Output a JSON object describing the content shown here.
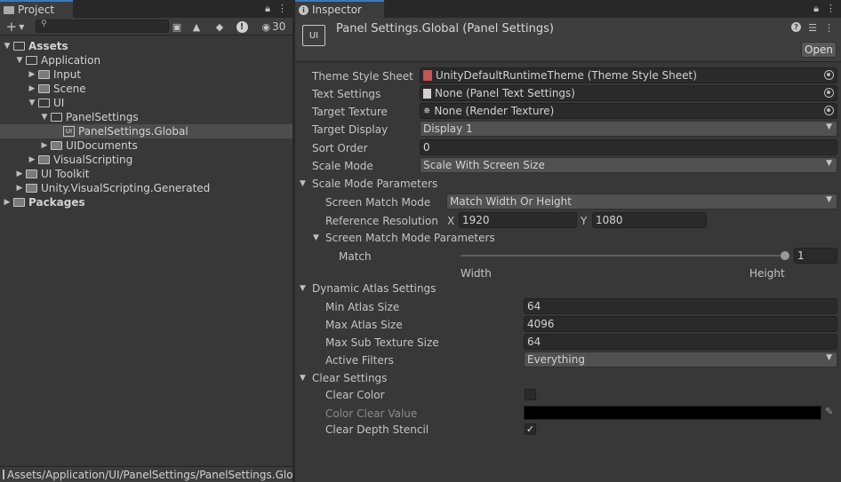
{
  "project": {
    "tab_label": "Project",
    "hidden_count": "30",
    "tree": [
      {
        "label": "Assets",
        "bold": true,
        "open": true
      },
      {
        "label": "Application",
        "open": true
      },
      {
        "label": "Input"
      },
      {
        "label": "Scene"
      },
      {
        "label": "UI",
        "open": true
      },
      {
        "label": "PanelSettings",
        "open": true
      },
      {
        "label": "PanelSettings.Global",
        "selected": true
      },
      {
        "label": "UIDocuments"
      },
      {
        "label": "VisualScripting"
      },
      {
        "label": "UI Toolkit"
      },
      {
        "label": "Unity.VisualScripting.Generated"
      },
      {
        "label": "Packages",
        "bold": true
      }
    ],
    "footer_path": "Assets/Application/UI/PanelSettings/PanelSettings.Global"
  },
  "inspector": {
    "tab_label": "Inspector",
    "title": "Panel Settings.Global (Panel Settings)",
    "open_label": "Open",
    "fields": {
      "theme_label": "Theme Style Sheet",
      "theme_value": "UnityDefaultRuntimeTheme (Theme Style Sheet)",
      "text_label": "Text Settings",
      "text_value": "None (Panel Text Settings)",
      "texture_label": "Target Texture",
      "texture_value": "None (Render Texture)",
      "display_label": "Target Display",
      "display_value": "Display 1",
      "sort_label": "Sort Order",
      "sort_value": "0",
      "scale_label": "Scale Mode",
      "scale_value": "Scale With Screen Size"
    },
    "scale_params": {
      "header": "Scale Mode Parameters",
      "match_mode_label": "Screen Match Mode",
      "match_mode_value": "Match Width Or Height",
      "ref_label": "Reference Resolution",
      "ref_x_label": "X",
      "ref_x": "1920",
      "ref_y_label": "Y",
      "ref_y": "1080",
      "sub_header": "Screen Match Mode Parameters",
      "match_label": "Match",
      "match_value": "1",
      "match_fraction": 1,
      "width_label": "Width",
      "height_label": "Height"
    },
    "atlas": {
      "header": "Dynamic Atlas Settings",
      "min_label": "Min Atlas Size",
      "min_value": "64",
      "max_label": "Max Atlas Size",
      "max_value": "4096",
      "sub_label": "Max Sub Texture Size",
      "sub_value": "64",
      "filters_label": "Active Filters",
      "filters_value": "Everything"
    },
    "clear": {
      "header": "Clear Settings",
      "color_label": "Clear Color",
      "color_checked": false,
      "value_label": "Color Clear Value",
      "color_value": "#000000",
      "depth_label": "Clear Depth Stencil",
      "depth_checked": true
    }
  }
}
